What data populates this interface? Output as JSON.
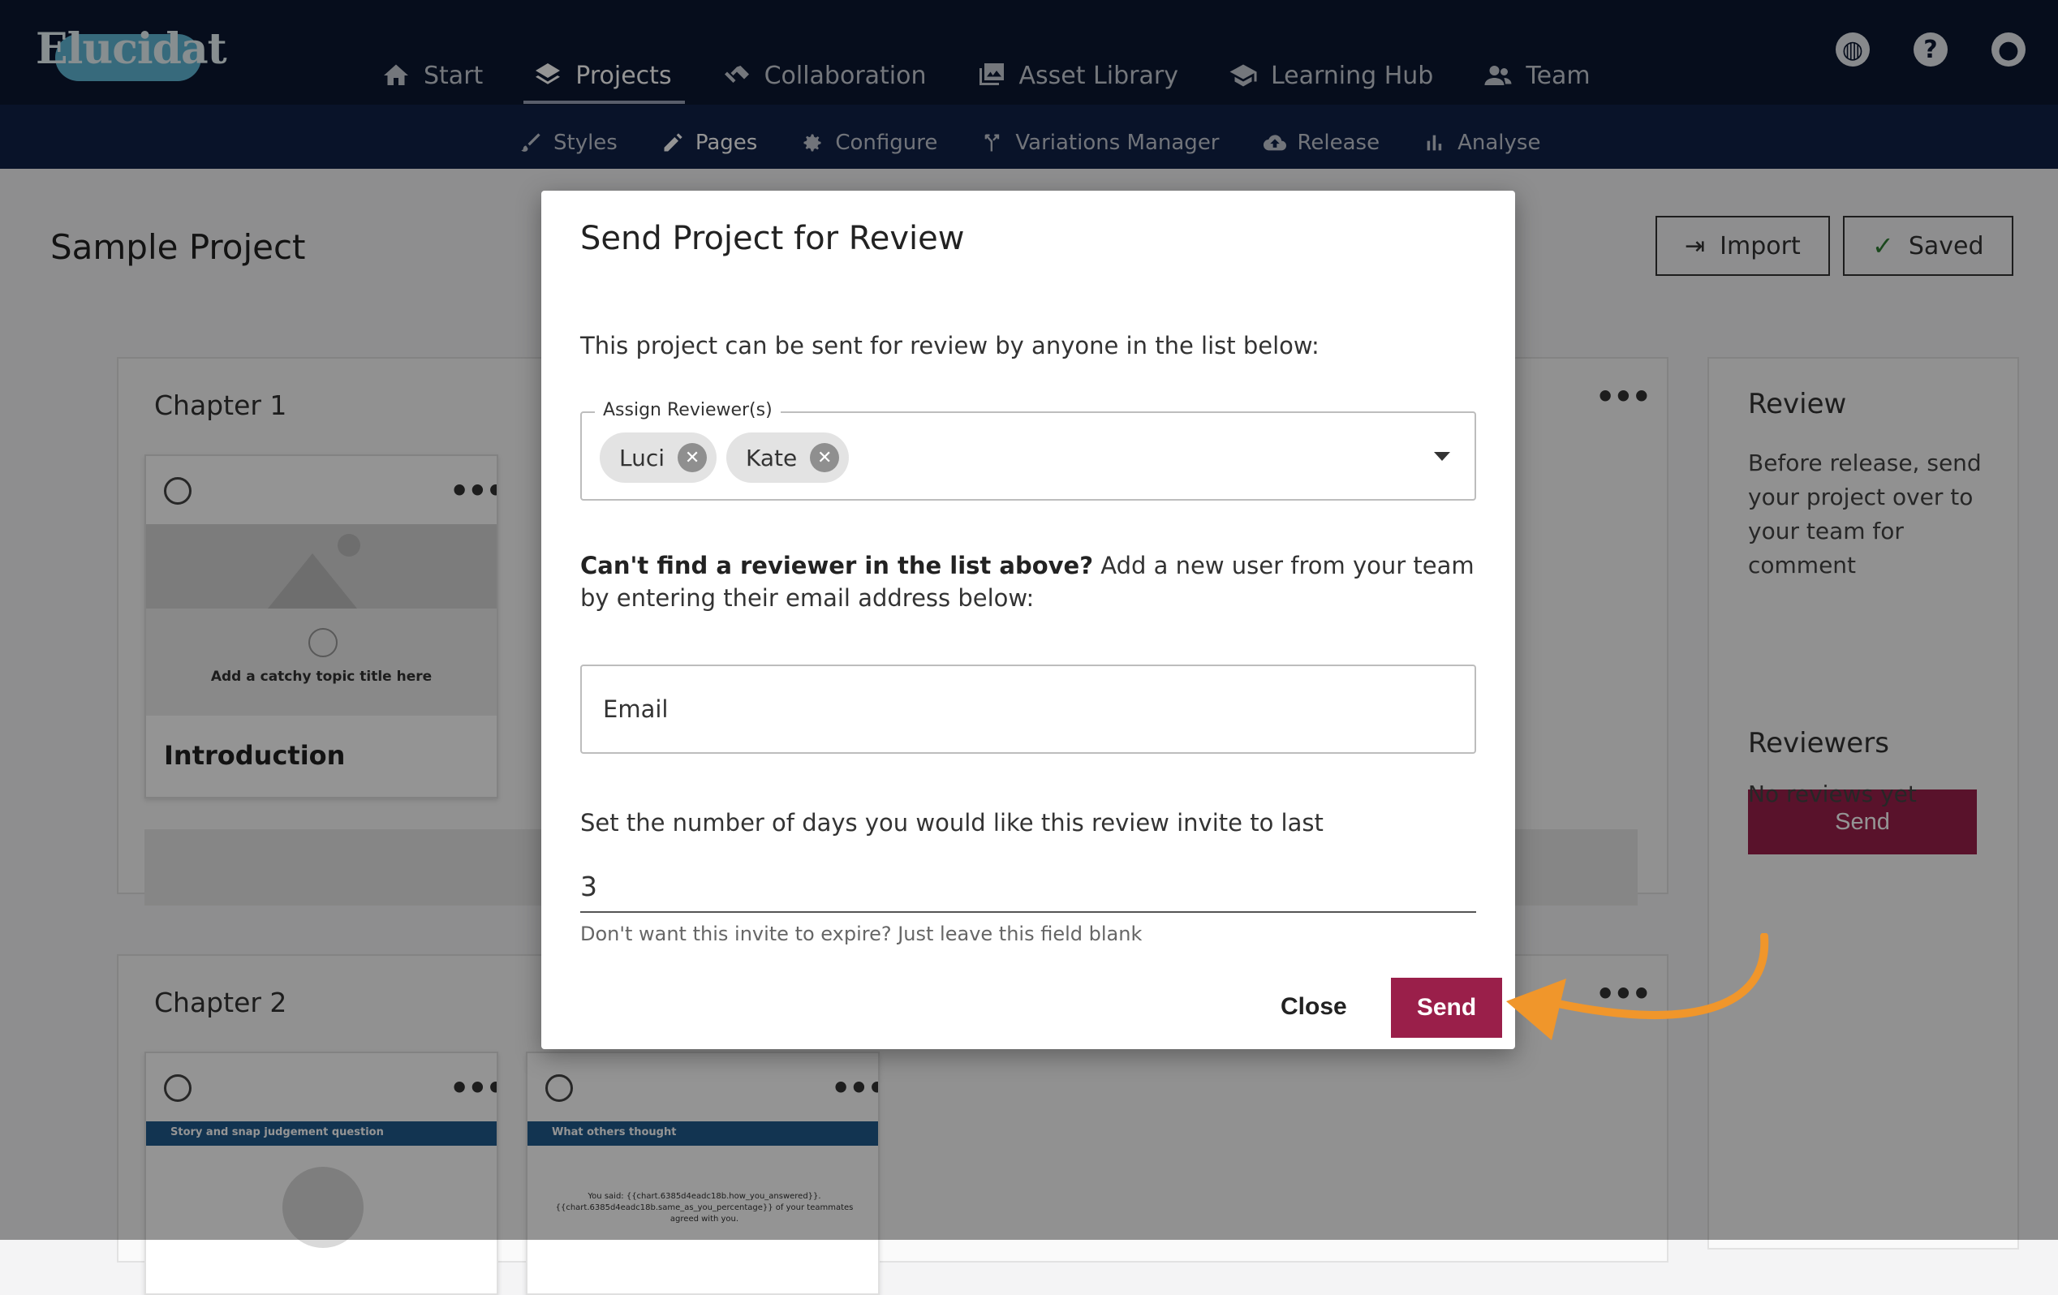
{
  "app": {
    "logo_text": "Elucidat"
  },
  "main_nav": [
    {
      "label": "Start",
      "icon": "home-icon"
    },
    {
      "label": "Projects",
      "icon": "layers-icon"
    },
    {
      "label": "Collaboration",
      "icon": "handshake-icon"
    },
    {
      "label": "Asset Library",
      "icon": "images-icon"
    },
    {
      "label": "Learning Hub",
      "icon": "graduation-cap-icon"
    },
    {
      "label": "Team",
      "icon": "users-icon"
    }
  ],
  "sub_nav": [
    {
      "label": "Styles",
      "icon": "brush-icon"
    },
    {
      "label": "Pages",
      "icon": "pencil-icon"
    },
    {
      "label": "Configure",
      "icon": "gear-icon"
    },
    {
      "label": "Variations Manager",
      "icon": "branch-icon"
    },
    {
      "label": "Release",
      "icon": "cloud-upload-icon"
    },
    {
      "label": "Analyse",
      "icon": "bar-chart-icon"
    }
  ],
  "page": {
    "title": "Sample Project",
    "import_label": "Import",
    "saved_label": "Saved",
    "chapters": [
      {
        "title": "Chapter 1",
        "card_title": "Introduction",
        "thumb_heading": "Add a catchy topic title here"
      },
      {
        "title": "Chapter 2",
        "card1_banner": "Story and snap judgement question",
        "card2_banner": "What others thought",
        "card2_text": "You said: {{chart.6385d4eadc18b.how_you_answered}}. {{chart.6385d4eadc18b.same_as_you_percentage}} of your teammates agreed with you."
      }
    ]
  },
  "review_panel": {
    "heading": "Review",
    "text": "Before release, send your project over to your team for comment",
    "send_label": "Send",
    "reviewers_heading": "Reviewers",
    "reviewers_empty": "No reviews yet"
  },
  "modal": {
    "title": "Send Project for Review",
    "intro": "This project can be sent for review by anyone in the list below:",
    "assign_legend": "Assign Reviewer(s)",
    "reviewers": [
      "Luci",
      "Kate"
    ],
    "cant_find_bold": "Can't find a reviewer in the list above?",
    "cant_find_rest": " Add a new user from your team by entering their email address below:",
    "email_placeholder": "Email",
    "days_label": "Set the number of days you would like this review invite to last",
    "days_value": "3",
    "days_help": "Don't want this invite to expire? Just leave this field blank",
    "close_label": "Close",
    "send_label": "Send"
  },
  "colors": {
    "nav_bg": "#0b1731",
    "subnav_bg": "#112248",
    "accent": "#9a1f4a",
    "arrow": "#f0962b"
  }
}
